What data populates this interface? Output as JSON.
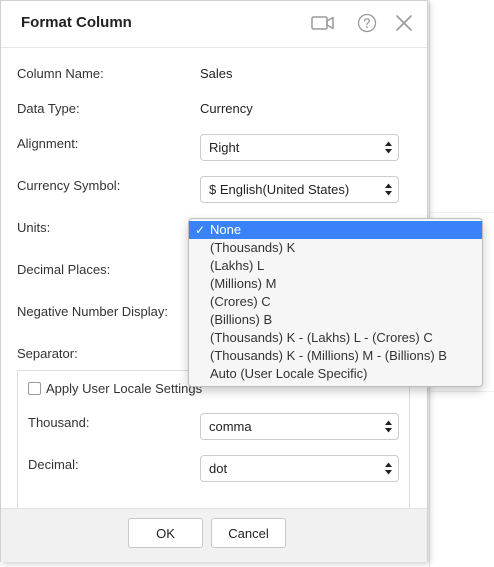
{
  "dialog": {
    "title": "Format Column"
  },
  "icons": {
    "video": "video-camera-icon",
    "help": "question-circle-icon",
    "close": "close-icon",
    "checkmark": "checkmark-icon"
  },
  "fields": {
    "column_name": {
      "label": "Column Name:",
      "value": "Sales"
    },
    "data_type": {
      "label": "Data Type:",
      "value": "Currency"
    },
    "alignment": {
      "label": "Alignment:",
      "value": "Right"
    },
    "currency_symbol": {
      "label": "Currency Symbol:",
      "value": "$ English(United States)"
    },
    "units": {
      "label": "Units:"
    },
    "decimal_places": {
      "label": "Decimal Places:"
    },
    "negative_number_display": {
      "label": "Negative Number Display:"
    },
    "separator": {
      "label": "Separator:"
    }
  },
  "separator_section": {
    "apply_locale_label": "Apply User Locale Settings",
    "apply_locale_checked": false,
    "thousand": {
      "label": "Thousand:",
      "value": "comma"
    },
    "decimal": {
      "label": "Decimal:",
      "value": "dot"
    }
  },
  "units_dropdown": {
    "selected": "None",
    "check_glyph": "✓",
    "options": [
      "None",
      "(Thousands) K",
      "(Lakhs) L",
      "(Millions) M",
      "(Crores) C",
      "(Billions) B",
      "(Thousands) K - (Lakhs) L - (Crores) C",
      "(Thousands) K - (Millions) M - (Billions) B",
      "Auto (User Locale Specific)"
    ]
  },
  "footer": {
    "ok_label": "OK",
    "cancel_label": "Cancel"
  },
  "colors": {
    "selection": "#3a82f7",
    "footer_bg": "#f1f1f1",
    "dropdown_bg": "#f6f6f6"
  }
}
